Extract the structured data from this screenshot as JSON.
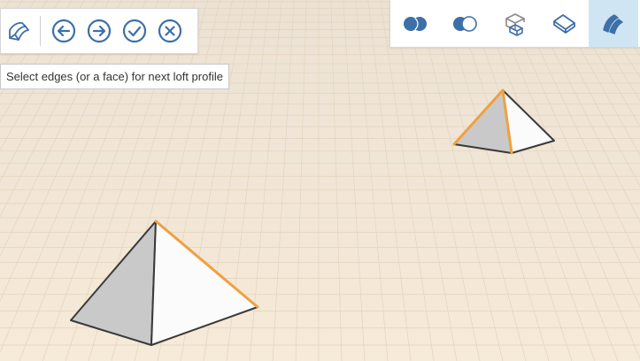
{
  "prompt": {
    "text": "Select edges (or a face) for next loft profile"
  },
  "left_toolbar": {
    "buttons": [
      {
        "icon": "loft-icon"
      },
      {
        "icon": "arrow-left-circle-icon"
      },
      {
        "icon": "arrow-right-circle-icon"
      },
      {
        "icon": "check-circle-icon"
      },
      {
        "icon": "close-circle-icon"
      }
    ]
  },
  "right_toolbar": {
    "buttons": [
      {
        "icon": "boolean-union-icon",
        "active": false
      },
      {
        "icon": "boolean-subtract-icon",
        "active": false
      },
      {
        "icon": "extrude-shape-icon",
        "active": false
      },
      {
        "icon": "face-plane-icon",
        "active": false
      },
      {
        "icon": "loft-icon",
        "active": true
      }
    ]
  },
  "colors": {
    "icon_blue": "#3d6fa8",
    "active_bg": "#cfe5f3",
    "selection_orange": "#f0a040",
    "ground": "#f2e6d6",
    "grid_line": "#e3d3bd"
  }
}
